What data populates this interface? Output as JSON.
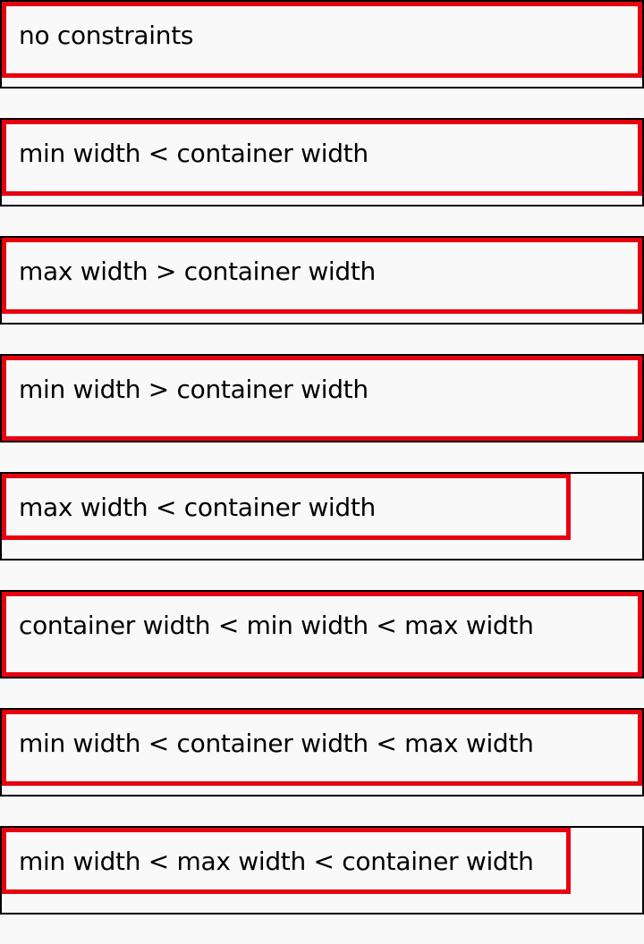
{
  "cases": [
    {
      "label": "no constraints",
      "colors": {
        "outer": "#000000",
        "inner": "#e8000f"
      }
    },
    {
      "label": "min width < container width"
    },
    {
      "label": "max width > container width"
    },
    {
      "label": "min width > container width"
    },
    {
      "label": "max width < container width"
    },
    {
      "label": "container width < min width < max width"
    },
    {
      "label": "min width < container width < max width"
    },
    {
      "label": "min width < max width < container width"
    }
  ]
}
